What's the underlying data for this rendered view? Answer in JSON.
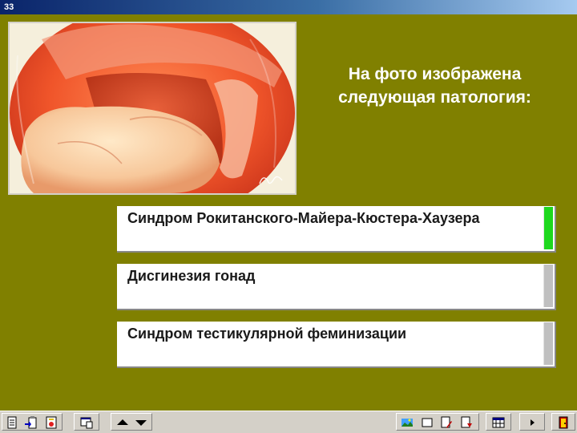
{
  "window": {
    "title": "33"
  },
  "question": {
    "line1": "На фото изображена",
    "line2": "следующая патология:"
  },
  "image": {
    "signature": "A. Cromm"
  },
  "answers": [
    {
      "label": "Синдром Рокитанского-Майера-Кюстера-Хаузера",
      "status": "correct"
    },
    {
      "label": "Дисгинезия гонад",
      "status": "neutral"
    },
    {
      "label": "Синдром тестикулярной феминизации",
      "status": "neutral"
    }
  ],
  "toolbar": {
    "icons": [
      "document-icon",
      "clipboard-arrow-icon",
      "certificate-icon",
      "monitor-window-icon",
      "arrow-up-icon",
      "arrow-down-icon",
      "landscape-image-icon",
      "window-icon",
      "document-edit-icon",
      "document-ref-icon",
      "calendar-grid-icon",
      "play-right-icon",
      "exit-door-icon"
    ]
  },
  "colors": {
    "background": "#808000",
    "correct": "#1ed81e",
    "neutral": "#c0c0c0"
  }
}
